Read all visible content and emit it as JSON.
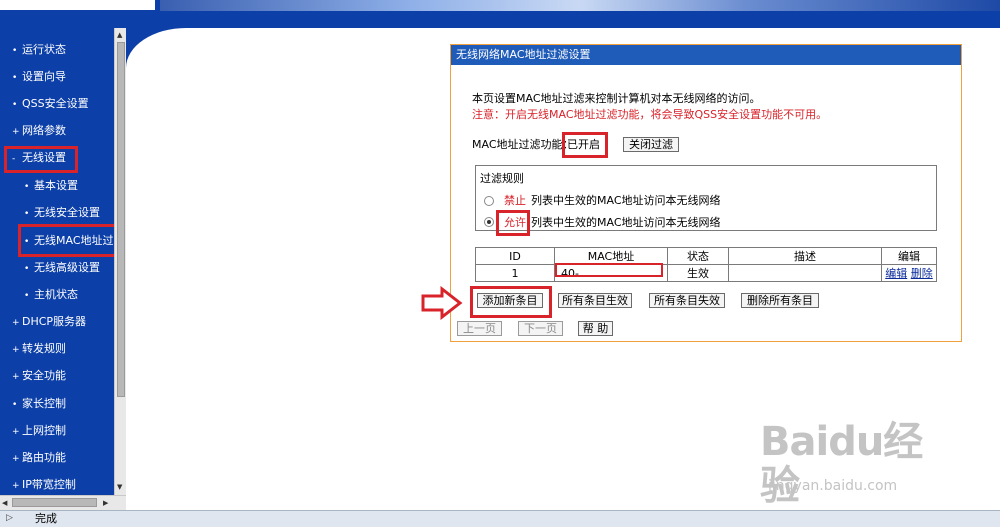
{
  "sidebar": {
    "items": [
      {
        "label": "运行状态",
        "bullet": "•"
      },
      {
        "label": "设置向导",
        "bullet": "•"
      },
      {
        "label": "QSS安全设置",
        "bullet": "•"
      },
      {
        "label": "网络参数",
        "bullet": "+"
      },
      {
        "label": "无线设置",
        "bullet": "-"
      },
      {
        "label": "基本设置",
        "bullet": "•"
      },
      {
        "label": "无线安全设置",
        "bullet": "•"
      },
      {
        "label": "无线MAC地址过滤",
        "bullet": "•"
      },
      {
        "label": "无线高级设置",
        "bullet": "•"
      },
      {
        "label": "主机状态",
        "bullet": "•"
      },
      {
        "label": "DHCP服务器",
        "bullet": "+"
      },
      {
        "label": "转发规则",
        "bullet": "+"
      },
      {
        "label": "安全功能",
        "bullet": "+"
      },
      {
        "label": "家长控制",
        "bullet": "•"
      },
      {
        "label": "上网控制",
        "bullet": "+"
      },
      {
        "label": "路由功能",
        "bullet": "+"
      },
      {
        "label": "IP带宽控制",
        "bullet": "+"
      }
    ]
  },
  "panel": {
    "title": "无线网络MAC地址过滤设置",
    "intro": "本页设置MAC地址过滤来控制计算机对本无线网络的访问。",
    "note": "注意：开启无线MAC地址过滤功能，将会导致QSS安全设置功能不可用。",
    "status_label": "MAC地址过滤功能：",
    "status_value": "已开启",
    "toggle_button": "关闭过滤",
    "rules_title": "过滤规则",
    "rule_deny_word": "禁止",
    "rule_deny_text": "列表中生效的MAC地址访问本无线网络",
    "rule_allow_word": "允许",
    "rule_allow_text": "列表中生效的MAC地址访问本无线网络",
    "table": {
      "headers": [
        "ID",
        "MAC地址",
        "状态",
        "描述",
        "编辑"
      ],
      "rows": [
        {
          "id": "1",
          "mac": "40-",
          "status": "生效",
          "desc": "",
          "edit": "编辑",
          "delete": "删除"
        }
      ]
    },
    "buttons": {
      "add": "添加新条目",
      "enable_all": "所有条目生效",
      "disable_all": "所有条目失效",
      "delete_all": "删除所有条目",
      "prev": "上一页",
      "next": "下一页",
      "help": "帮 助"
    }
  },
  "statusbar": {
    "text": "完成"
  },
  "watermark": {
    "logo": "Baidu经验",
    "url": "jingyan.baidu.com"
  },
  "colors": {
    "nav_bg": "#0c3fa8",
    "title_bg": "#1f5bb8",
    "highlight": "#d8232a",
    "panel_border": "#f0a03c"
  }
}
